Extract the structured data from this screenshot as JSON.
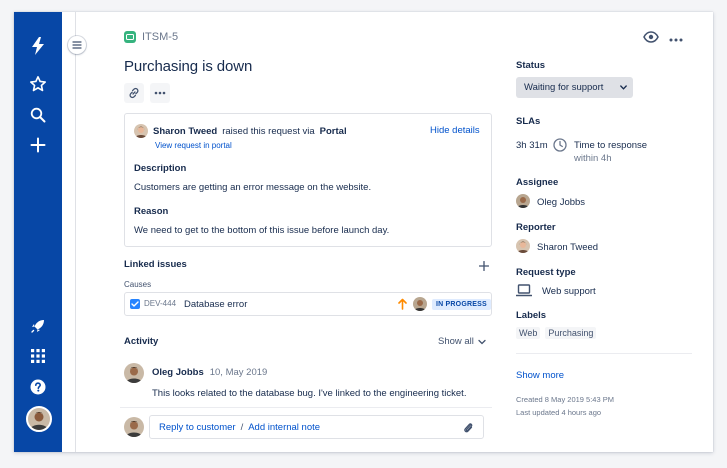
{
  "header": {
    "issue_key": "ITSM-5",
    "title": "Purchasing is down"
  },
  "request": {
    "reporter_name": "Sharon Tweed",
    "raised_text": "raised this request via",
    "channel": "Portal",
    "hide_details": "Hide details",
    "view_request": "View request in portal",
    "description_label": "Description",
    "description_text": "Customers are getting an error message on the website.",
    "reason_label": "Reason",
    "reason_text": "We need to get to the bottom of this issue before launch day."
  },
  "linked_issues": {
    "title": "Linked issues",
    "relation": "Causes",
    "items": [
      {
        "key": "DEV-444",
        "summary": "Database error",
        "status": "IN PROGRESS"
      }
    ]
  },
  "activity": {
    "title": "Activity",
    "filter_label": "Show all",
    "comments": [
      {
        "author": "Oleg Jobbs",
        "date": "10, May 2019",
        "text": "This looks related to the database bug. I've linked to the engineering ticket."
      }
    ],
    "reply_to_customer": "Reply to customer",
    "separator": "/",
    "add_internal_note": "Add internal note"
  },
  "details": {
    "status_label": "Status",
    "status_value": "Waiting for support",
    "slas_label": "SLAs",
    "sla_time": "3h 31m",
    "sla_name": "Time to response",
    "sla_target": "within 4h",
    "assignee_label": "Assignee",
    "assignee": "Oleg Jobbs",
    "reporter_label": "Reporter",
    "reporter": "Sharon Tweed",
    "request_type_label": "Request type",
    "request_type": "Web support",
    "labels_label": "Labels",
    "labels": [
      "Web",
      "Purchasing"
    ],
    "show_more": "Show more",
    "created": "Created 8 May 2019 5:43 PM",
    "updated": "Last updated 4 hours ago"
  },
  "colors": {
    "nav_blue": "#0747a6",
    "link_blue": "#0052cc",
    "itsm_green": "#36b37e",
    "priority_orange": "#ff8b00"
  }
}
